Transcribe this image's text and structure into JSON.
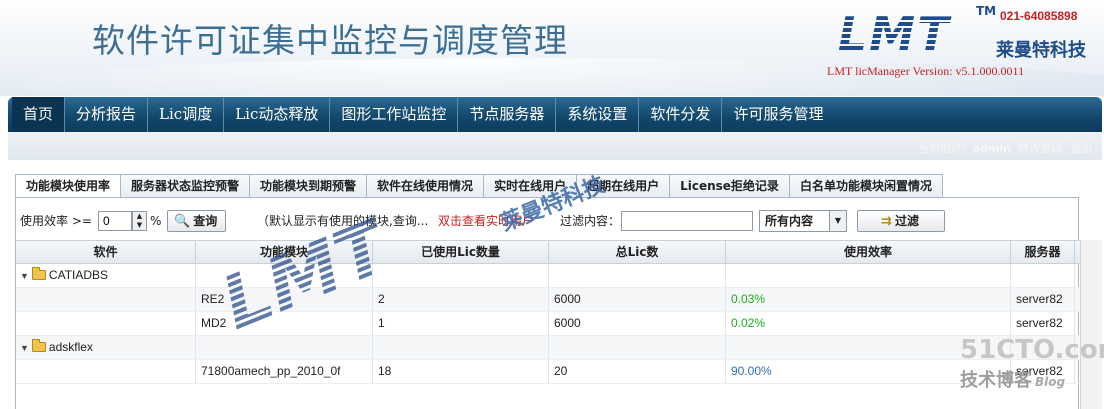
{
  "header": {
    "title": "软件许可证集中监控与调度管理",
    "logo_text": "LMT",
    "tm": "TM",
    "phone": "021-64085898",
    "company": "莱曼特科技",
    "version": "LMT licManager Version: v5.1.000.0011"
  },
  "nav": {
    "items": [
      {
        "label": "首页"
      },
      {
        "label": "分析报告"
      },
      {
        "label": "Lic调度"
      },
      {
        "label": "Lic动态释放"
      },
      {
        "label": "图形工作站监控"
      },
      {
        "label": "节点服务器"
      },
      {
        "label": "系统设置"
      },
      {
        "label": "软件分发"
      },
      {
        "label": "许可服务管理"
      }
    ],
    "user_label": "当前用户：",
    "user_name": "admin",
    "change_password": "修改密码",
    "logout": "退出"
  },
  "tabs": [
    {
      "label": "功能模块使用率",
      "active": true
    },
    {
      "label": "服务器状态监控预警"
    },
    {
      "label": "功能模块到期预警"
    },
    {
      "label": "软件在线使用情况"
    },
    {
      "label": "实时在线用户"
    },
    {
      "label": "超期在线用户"
    },
    {
      "label": "License拒绝记录"
    },
    {
      "label": "白名单功能模块闲置情况"
    }
  ],
  "toolbar": {
    "efficiency_label": "使用效率 >=",
    "efficiency_value": "0",
    "percent": "%",
    "query_button": "查询",
    "hint": "（默认显示有使用的模块,查询...",
    "dblclick_hint": "双击查看实时用户",
    "filter_label": "过滤内容：",
    "filter_value": "",
    "select_value": "所有内容",
    "filter_button": "过滤"
  },
  "grid": {
    "columns": [
      "软件",
      "功能模块",
      "已使用Lic数量",
      "总Lic数",
      "使用效率",
      "服务器"
    ],
    "rows": [
      {
        "software": "CATIADBS",
        "module": "",
        "used": "",
        "total": "",
        "efficiency": "",
        "server": "",
        "group": true
      },
      {
        "software": "",
        "module": "RE2",
        "used": "2",
        "total": "6000",
        "efficiency": "0.03%",
        "server": "server82"
      },
      {
        "software": "",
        "module": "MD2",
        "used": "1",
        "total": "6000",
        "efficiency": "0.02%",
        "server": "server82"
      },
      {
        "software": "adskflex",
        "module": "",
        "used": "",
        "total": "",
        "efficiency": "",
        "server": "",
        "group": true
      },
      {
        "software": "",
        "module": "71800amech_pp_2010_0f",
        "used": "18",
        "total": "20",
        "efficiency": "90.00%",
        "server": "server82"
      }
    ]
  },
  "watermarks": {
    "lmt": "LMT",
    "company": "莱曼特科技",
    "site": "51CTO.com",
    "blog": "技术博客",
    "blog_en": "Blog"
  },
  "colors": {
    "nav_bg": "#14496d",
    "title": "#3d6e93",
    "accent_red": "#c81f1f",
    "green": "#1fae1f",
    "blue": "#2b6fb3"
  }
}
